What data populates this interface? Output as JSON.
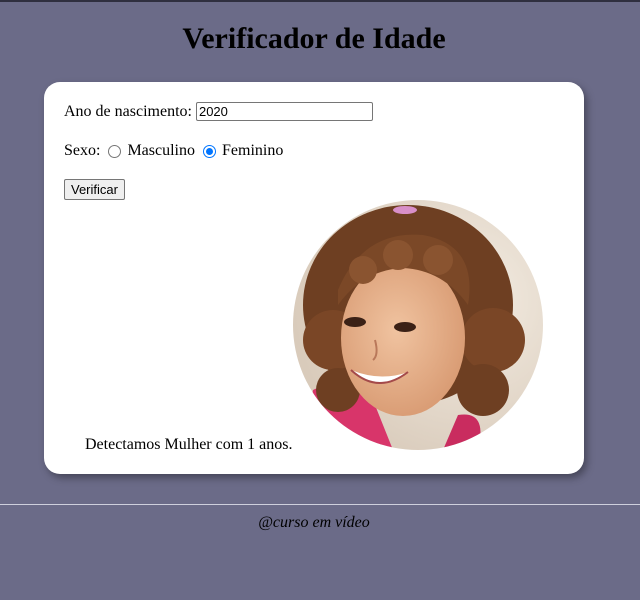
{
  "page": {
    "title": "Verificador de Idade",
    "footer": "@curso em vídeo"
  },
  "form": {
    "year_label": "Ano de nascimento:",
    "year_value": "2020",
    "sex_label": "Sexo:",
    "options": [
      "Masculino",
      "Feminino"
    ],
    "selected_option": "Feminino",
    "button_label": "Verificar"
  },
  "result": {
    "text": "Detectamos Mulher com 1 anos."
  },
  "colors": {
    "background": "#6b6b88",
    "card": "#ffffff",
    "radio_accent": "#0075ff"
  }
}
